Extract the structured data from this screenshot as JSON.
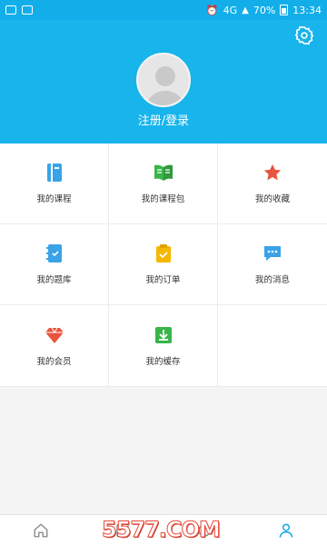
{
  "status_bar": {
    "battery_text": "70%",
    "time": "13:34",
    "signal_label": "4G"
  },
  "header": {
    "login_text": "注册/登录"
  },
  "grid": [
    {
      "label": "我的课程",
      "icon": "book-icon",
      "color": "#3aa3e8"
    },
    {
      "label": "我的课程包",
      "icon": "open-book-icon",
      "color": "#39b54a"
    },
    {
      "label": "我的收藏",
      "icon": "star-icon",
      "color": "#e8553e"
    },
    {
      "label": "我的题库",
      "icon": "notebook-icon",
      "color": "#3aa3e8"
    },
    {
      "label": "我的订单",
      "icon": "clipboard-icon",
      "color": "#f5b700"
    },
    {
      "label": "我的消息",
      "icon": "chat-icon",
      "color": "#3aa3e8"
    },
    {
      "label": "我的会员",
      "icon": "diamond-icon",
      "color": "#e8553e"
    },
    {
      "label": "我的缓存",
      "icon": "download-icon",
      "color": "#39b54a"
    },
    {
      "label": "",
      "icon": "",
      "color": ""
    }
  ],
  "tabbar": {
    "active_tab": "profile"
  },
  "watermark": "5577.COM",
  "colors": {
    "header": "#18b4ec",
    "accent": "#1aa5e0"
  }
}
